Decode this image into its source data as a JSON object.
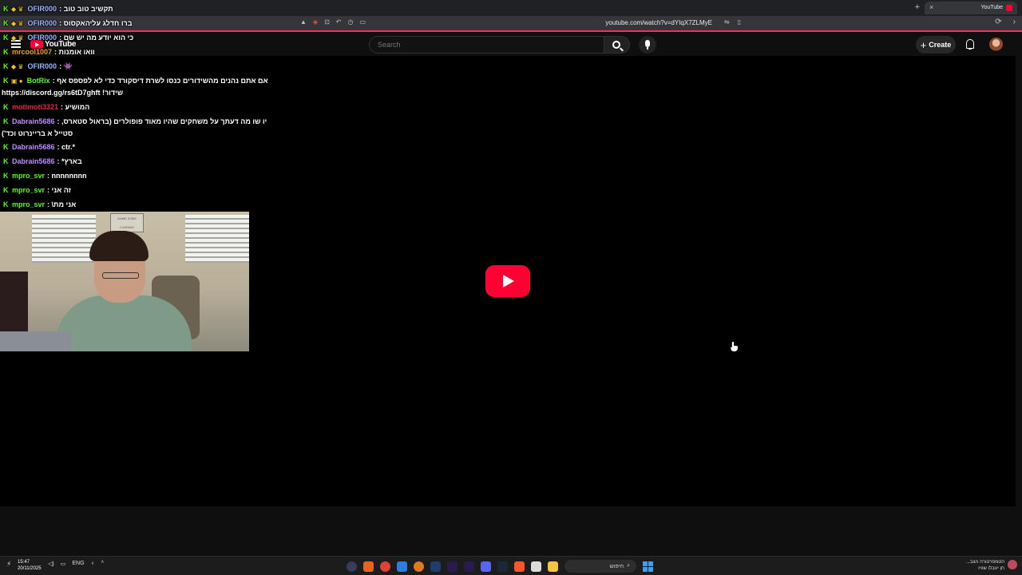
{
  "browser": {
    "tab_title": "YouTube",
    "tab_close": "×",
    "new_tab": "+",
    "url": "youtube.com/watch?v=dYIqX7ZLMyE",
    "nav_reload": "⟳",
    "nav_forward": "›"
  },
  "youtube": {
    "logo_text": "YouTube",
    "search_placeholder": "Search",
    "create_label": "Create",
    "create_plus": "+",
    "brand_color": "#ff0033"
  },
  "chat": [
    {
      "user": "OFIR000",
      "user_color": "#9ab4ff",
      "text": "תקשיב טוב טוב",
      "badges": "◆ ♛"
    },
    {
      "user": "OFIR000",
      "user_color": "#9ab4ff",
      "text": "ברו חדלג עליהאקסוס",
      "badges": "◆ ♛"
    },
    {
      "user": "OFIR000",
      "user_color": "#9ab4ff",
      "text": "כי הוא יודע מה יש שם",
      "badges": "◆ ♛"
    },
    {
      "user": "mrcool1007",
      "user_color": "#f0a020",
      "text": "וואו אומנות",
      "badges": ""
    },
    {
      "user": "OFIR000",
      "user_color": "#9ab4ff",
      "text": "👾",
      "badges": "◆ ♛"
    },
    {
      "user": "BotRix",
      "user_color": "#53fc18",
      "text": "אם אתם נהנים מהשידורים כנסו לשרת דיסקורד כדי לא לפספס אף",
      "badges": "▣ ●"
    },
    {
      "user": "",
      "user_color": "#ffffff",
      "text": "שידור! https://discord.gg/rs6tD7ghft",
      "badges": ""
    },
    {
      "user": "motimoti3321",
      "user_color": "#e0284d",
      "text": "המושיע",
      "badges": ""
    },
    {
      "user": "Dabrain5686",
      "user_color": "#c08cff",
      "text": "יו שו מה דעתך על משחקים שהיו מאוד פופולרים (בראול סטארס,",
      "badges": ""
    },
    {
      "user": "",
      "user_color": "#ffffff",
      "text": "סטייל א בריינרוט וכד')",
      "badges": ""
    },
    {
      "user": "Dabrain5686",
      "user_color": "#c08cff",
      "text": "ctr.*",
      "badges": ""
    },
    {
      "user": "Dabrain5686",
      "user_color": "#c08cff",
      "text": "בארץ*",
      "badges": ""
    },
    {
      "user": "mpro_svr",
      "user_color": "#53fc18",
      "text": "nnnnnnnn",
      "badges": ""
    },
    {
      "user": "mpro_svr",
      "user_color": "#53fc18",
      "text": "זה אני",
      "badges": ""
    },
    {
      "user": "mpro_svr",
      "user_color": "#53fc18",
      "text": "אני מת\\",
      "badges": ""
    }
  ],
  "webcam": {
    "sign_text": "GAME ZONE",
    "sign_loading": "LOADING"
  },
  "taskbar": {
    "time": "15:47",
    "date": "20/11/2025",
    "lang": "ENG",
    "search_label": "חיפוש",
    "news_title": "הטמפרטורה הצב...",
    "news_sub": "חן יעבלו שוויו"
  }
}
